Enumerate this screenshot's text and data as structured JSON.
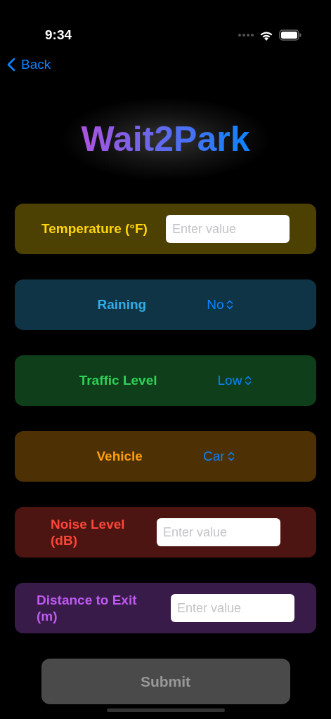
{
  "status_bar": {
    "time": "9:34"
  },
  "nav": {
    "back": "Back"
  },
  "title": "Wait2Park",
  "fields": [
    {
      "kind": "input",
      "label": "Temperature (°F)",
      "color": "#ffd60a",
      "placeholder": "Enter value"
    },
    {
      "kind": "picker",
      "label": "Raining",
      "color": "#32ade6",
      "value": "No"
    },
    {
      "kind": "picker",
      "label": "Traffic Level",
      "color": "#30d158",
      "value": "Low"
    },
    {
      "kind": "picker",
      "label": "Vehicle",
      "color": "#ff9f0a",
      "value": "Car"
    },
    {
      "kind": "input",
      "label": "Noise Level (dB)",
      "color": "#ff453a",
      "placeholder": "Enter value"
    },
    {
      "kind": "input",
      "label": "Distance to Exit (m)",
      "color": "#bf5af2",
      "placeholder": "Enter value"
    }
  ],
  "submit": {
    "label": "Submit",
    "disabled": true
  }
}
